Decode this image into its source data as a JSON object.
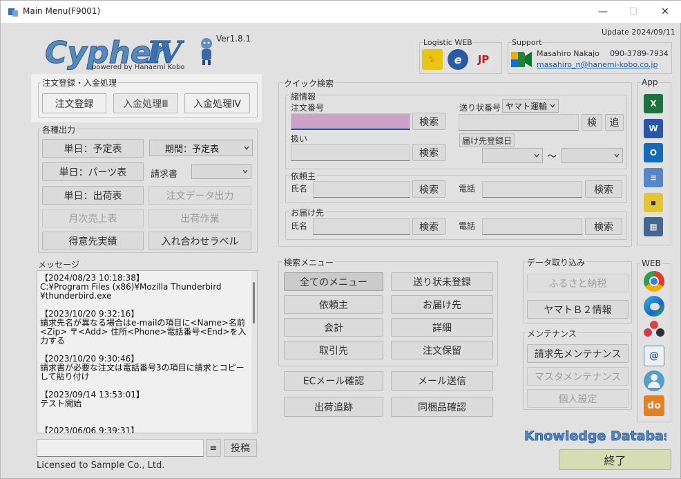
{
  "window": {
    "title": "Main Menu(F9001)",
    "minimize": "—",
    "maximize": "☐",
    "close": "✕"
  },
  "header": {
    "logo": "CypherⅣ",
    "logo_tagline": "powered by Hanaemi Kobo",
    "version": "Ver1.8.1",
    "update": "Update 2024/09/11",
    "logistic_title": "Logistic WEB",
    "support_title": "Support",
    "support_name": "Masahiro Nakajo",
    "support_phone": "090-3789-7934",
    "support_email": "masahiro_n@hanemi-kobo.co.jp"
  },
  "order_group": {
    "title": "注文登録・入金処理",
    "buttons": [
      "注文登録",
      "入金処理Ⅲ",
      "入金処理Ⅳ"
    ]
  },
  "output_group": {
    "title": "各種出力",
    "buttons": [
      "単日：予定表",
      "単日：パーツ表",
      "単日：出荷表",
      "月次売上表",
      "得意先実績",
      "入れ合わせラベル",
      "期間：予定表",
      "請求書",
      "注文データ出力",
      "出荷作業"
    ],
    "period_select": "期間：予定表",
    "invoice_label": "請求書"
  },
  "quick_search": {
    "title": "クイック検索",
    "info_title": "諸情報",
    "order_no_label": "注文番号",
    "handling_label": "扱い",
    "tracking_label": "送り状番号",
    "carrier": "ヤマト運輸",
    "search": "検索",
    "inspect": "検",
    "add": "追",
    "delivery_date_button": "届け先登録日",
    "tilde": "～",
    "requester_title": "依頼主",
    "name_label": "氏名",
    "phone_label": "電話",
    "recipient_title": "お届け先"
  },
  "search_menu": {
    "title": "検索メニュー",
    "buttons": [
      "全てのメニュー",
      "送り状未登録",
      "依頼主",
      "お届け先",
      "会計",
      "詳細",
      "取引先",
      "注文保留"
    ],
    "extra": [
      "ECメール確認",
      "メール送信",
      "出荷追跡",
      "同梱品確認"
    ]
  },
  "data_import": {
    "title": "データ取り込み",
    "buttons": [
      "ふるさと納税",
      "ヤマトＢ２情報"
    ]
  },
  "maintenance": {
    "title": "メンテナンス",
    "buttons": [
      "請求先メンテナンス",
      "マスタメンテナンス",
      "個人設定"
    ]
  },
  "app_panel": {
    "title": "App",
    "icons": [
      "excel-icon",
      "word-icon",
      "outlook-icon",
      "notepad-icon",
      "sticky-notes-icon",
      "calculator-icon"
    ]
  },
  "web_panel": {
    "title": "WEB",
    "icons": [
      "chrome-icon",
      "edge-icon",
      "flower-icon",
      "mail-icon",
      "user-icon",
      "do-icon"
    ]
  },
  "messages": {
    "title": "メッセージ",
    "text": "【2024/08/23 10:18:38】\nC:¥Program Files (x86)¥Mozilla Thunderbird\n¥thunderbird.exe\n\n【2023/10/20 9:32:16】\n請求先名が異なる場合はe-mailの項目に<Name>名前\n<Zip> 〒<Add> 住所<Phone>電話番号<End>を入力する\n\n【2023/10/20 9:30:46】\n請求書が必要な注文は電話番号3の項目に請求とコピーして貼り付け\n\n【2023/09/14 13:53:01】\nテスト開始\n\n\n【2023/06/06 9:39:31】",
    "post_button": "投稿",
    "menu_button": "≡"
  },
  "knowledge": "Knowledge Database",
  "exit_button": "終了",
  "license": "Licensed to Sample Co., Ltd.",
  "colors": {
    "accent": "#4a86c5",
    "order_input": "#d9aed3",
    "exit_bg": "#e4ebc0"
  }
}
